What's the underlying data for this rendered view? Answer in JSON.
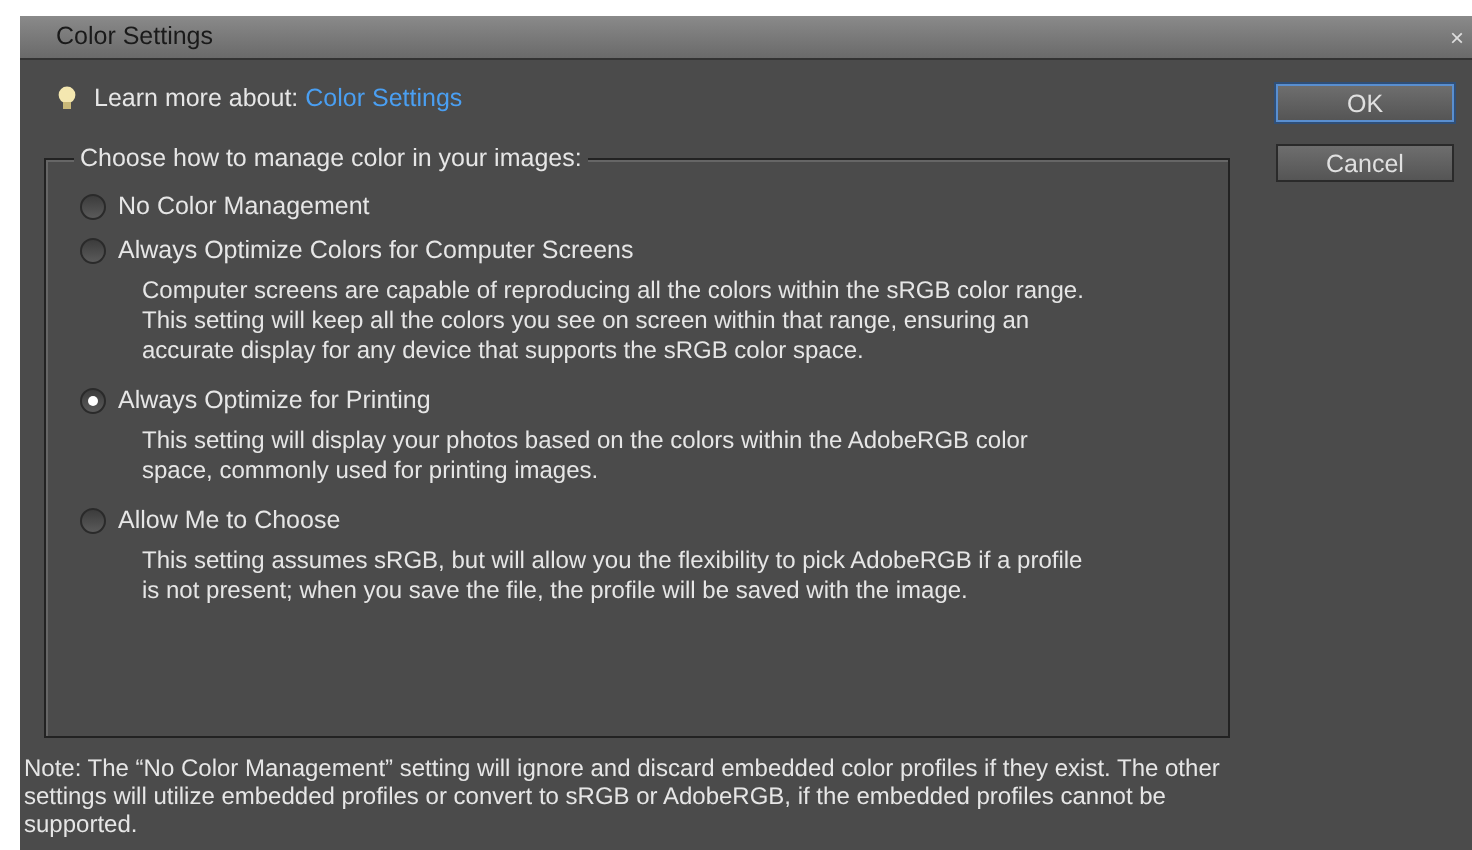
{
  "window": {
    "title": "Color Settings",
    "close": "×"
  },
  "learn_more": {
    "label": "Learn more about:",
    "link": "Color Settings"
  },
  "buttons": [
    {
      "label": "OK",
      "default": true
    },
    {
      "label": "Cancel",
      "default": false
    }
  ],
  "group": {
    "legend": "Choose how to manage color in your images:",
    "options": [
      {
        "label": "No Color Management",
        "selected": false
      },
      {
        "label": "Always Optimize Colors for Computer Screens",
        "selected": false,
        "description": "Computer screens are capable of reproducing all the colors within the sRGB color range. This setting will keep all the colors you see on screen within that range, ensuring an accurate display for any device that supports the sRGB color space."
      },
      {
        "label": "Always Optimize for Printing",
        "selected": true,
        "description": "This setting will display your photos based on the colors within the AdobeRGB color space, commonly used for printing images."
      },
      {
        "label": "Allow Me to Choose",
        "selected": false,
        "description": "This setting assumes sRGB, but will allow you the flexibility to pick AdobeRGB if a profile is not present; when you save the file, the profile will be saved with the image."
      }
    ]
  },
  "note": "Note: The “No Color Management” setting will ignore and discard embedded color profiles if they exist. The other settings will utilize embedded profiles or convert to sRGB or AdobeRGB, if the embedded profiles cannot be supported."
}
